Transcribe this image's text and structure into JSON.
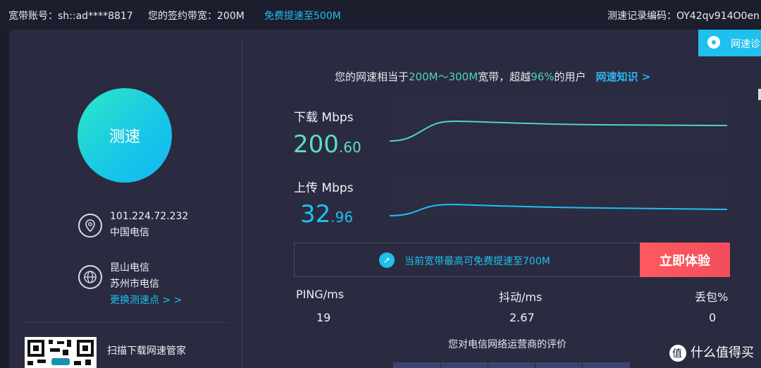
{
  "topbar": {
    "account": "宽带账号：sh::ad****8817",
    "bandwidth": "您的签约带宽：200M",
    "free_boost": "免费提速至500M",
    "record_code": "测速记录编码：OY42qv914O0en"
  },
  "diagnose_button": {
    "label": "网速诊"
  },
  "sidebar": {
    "speed_test_label": "测速",
    "ip": "101.224.72.232",
    "isp": "中国电信",
    "node_city": "昆山电信",
    "node_region": "苏州市电信",
    "change_node": "更换测速点 > >",
    "qr_caption": "扫描下载网速管家"
  },
  "summary": {
    "prefix": "您的网速相当于",
    "range": "200M～300M",
    "middle": "宽带，超越",
    "percent": "96%",
    "suffix": "的用户",
    "knowledge_link": "网速知识 >"
  },
  "download": {
    "label": "下载 Mbps",
    "int": "200",
    "dec": ".60"
  },
  "upload": {
    "label": "上传 Mbps",
    "int": "32",
    "dec": ".96"
  },
  "promo": {
    "text": "当前宽带最高可免费提速至700M",
    "cta": "立即体验"
  },
  "stats": {
    "ping_label": "PING/ms",
    "ping_value": "19",
    "jitter_label": "抖动/ms",
    "jitter_value": "2.67",
    "loss_label": "丢包%",
    "loss_value": "0"
  },
  "rating": {
    "title": "您对电信网络运营商的评价"
  },
  "watermark": {
    "text": "什么值得买"
  },
  "colors": {
    "accent": "#1ec0ee",
    "green": "#4fd6b8",
    "cta": "#f24d5c"
  }
}
